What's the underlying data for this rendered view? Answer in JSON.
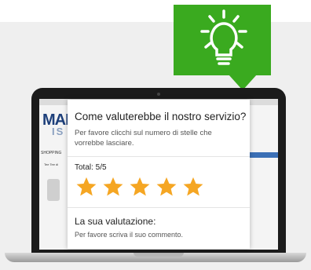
{
  "tip": {
    "icon": "lightbulb-icon",
    "color": "#3aaa1f"
  },
  "background_site": {
    "logo_text_1": "MAD",
    "logo_text_2": "IS",
    "nav_label": "SHOPPING",
    "nav_sub": "Tee Tee di"
  },
  "modal": {
    "title": "Come valuterebbe il nostro servizio?",
    "subtitle": "Per favore clicchi sul numero di stelle che vorrebbe lasciare.",
    "total_label": "Total: 5/5",
    "rating": {
      "value": 5,
      "max": 5
    },
    "star_color": "#f5a623",
    "review_title": "La sua valutazione:",
    "review_prompt": "Per favore scriva il suo commento."
  }
}
